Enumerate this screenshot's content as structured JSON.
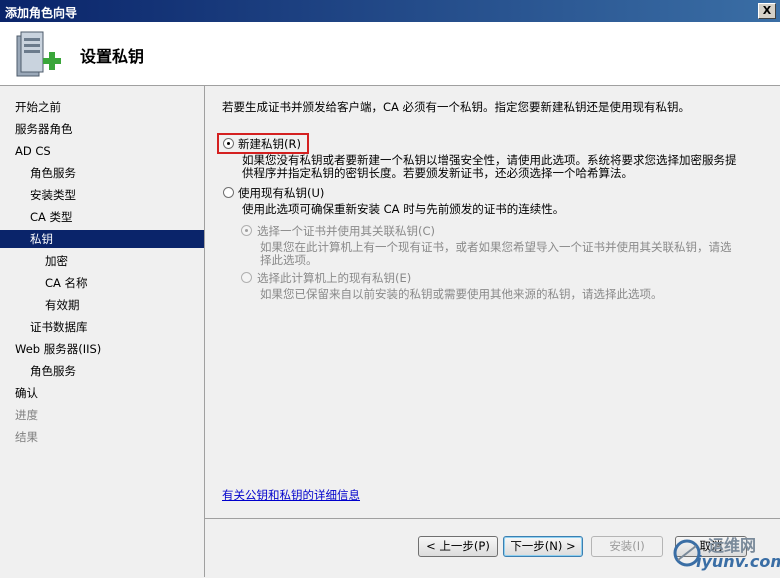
{
  "window": {
    "title": "添加角色向导",
    "close_label": "X"
  },
  "header": {
    "title": "设置私钥",
    "icon": "server-add-icon"
  },
  "sidebar": {
    "items": [
      {
        "label": "开始之前",
        "level": 0,
        "state": "normal"
      },
      {
        "label": "服务器角色",
        "level": 0,
        "state": "normal"
      },
      {
        "label": "AD CS",
        "level": 0,
        "state": "normal"
      },
      {
        "label": "角色服务",
        "level": 1,
        "state": "normal"
      },
      {
        "label": "安装类型",
        "level": 1,
        "state": "normal"
      },
      {
        "label": "CA 类型",
        "level": 1,
        "state": "normal"
      },
      {
        "label": "私钥",
        "level": 1,
        "state": "selected"
      },
      {
        "label": "加密",
        "level": 2,
        "state": "normal"
      },
      {
        "label": "CA 名称",
        "level": 2,
        "state": "normal"
      },
      {
        "label": "有效期",
        "level": 2,
        "state": "normal"
      },
      {
        "label": "证书数据库",
        "level": 1,
        "state": "normal"
      },
      {
        "label": "Web 服务器(IIS)",
        "level": 0,
        "state": "normal"
      },
      {
        "label": "角色服务",
        "level": 1,
        "state": "normal"
      },
      {
        "label": "确认",
        "level": 0,
        "state": "normal"
      },
      {
        "label": "进度",
        "level": 0,
        "state": "disabled"
      },
      {
        "label": "结果",
        "level": 0,
        "state": "disabled"
      }
    ]
  },
  "main": {
    "intro": "若要生成证书并颁发给客户端，CA 必须有一个私钥。指定您要新建私钥还是使用现有私钥。",
    "option_new": {
      "label": "新建私钥(R)",
      "checked": true,
      "desc_line1": "如果您没有私钥或者要新建一个私钥以增强安全性，请使用此选项。系统将要求您选择加密服务提",
      "desc_line2": "供程序并指定私钥的密钥长度。若要颁发新证书，还必须选择一个哈希算法。"
    },
    "option_existing": {
      "label": "使用现有私钥(U)",
      "checked": false,
      "desc": "使用此选项可确保重新安装 CA 时与先前颁发的证书的连续性。"
    },
    "sub_option_cert": {
      "label": "选择一个证书并使用其关联私钥(C)",
      "checked": true,
      "desc_line1": "如果您在此计算机上有一个现有证书，或者如果您希望导入一个证书并使用其关联私钥，请选",
      "desc_line2": "择此选项。"
    },
    "sub_option_key": {
      "label": "选择此计算机上的现有私钥(E)",
      "checked": false,
      "desc": "如果您已保留来自以前安装的私钥或需要使用其他来源的私钥，请选择此选项。"
    },
    "details_link": "有关公钥和私钥的详细信息"
  },
  "buttons": {
    "prev": "< 上一步(P)",
    "next": "下一步(N) >",
    "install": "安装(I)",
    "cancel": "取消"
  },
  "watermark": {
    "line1": "运维网",
    "line2": "iyunv.com"
  },
  "colors": {
    "selection": "#0a246a",
    "highlight_border": "#d42020",
    "link": "#0000cc"
  }
}
